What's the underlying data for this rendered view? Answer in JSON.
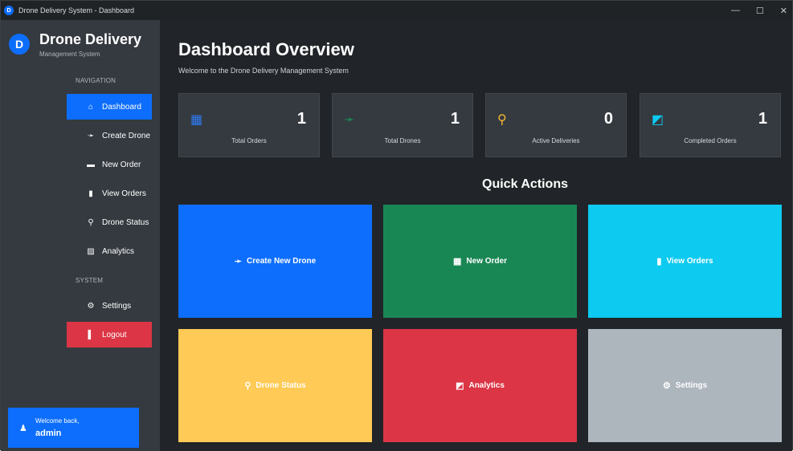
{
  "window": {
    "title": "Drone Delivery System - Dashboard",
    "icon_letter": "D",
    "controls": {
      "minimize": "—",
      "maximize": "☐",
      "close": "✕"
    }
  },
  "sidebar": {
    "logo_letter": "D",
    "brand_title": "Drone Delivery",
    "brand_subtitle": "Management System",
    "nav_label": "NAVIGATION",
    "system_label": "SYSTEM",
    "items": [
      {
        "label": "Dashboard",
        "icon": "home-icon",
        "glyph": "⌂"
      },
      {
        "label": "Create Drone",
        "icon": "drone-icon",
        "glyph": "➛"
      },
      {
        "label": "New Order",
        "icon": "gift-icon",
        "glyph": "▬"
      },
      {
        "label": "View Orders",
        "icon": "clipboard-icon",
        "glyph": "▮"
      },
      {
        "label": "Drone Status",
        "icon": "satellite-icon",
        "glyph": "⚲"
      },
      {
        "label": "Analytics",
        "icon": "chart-icon",
        "glyph": "▨"
      }
    ],
    "settings": {
      "label": "Settings",
      "icon": "gear-icon",
      "glyph": "⚙"
    },
    "logout": {
      "label": "Logout",
      "icon": "door-icon",
      "glyph": "▌"
    },
    "welcome": {
      "line1": "Welcome back,",
      "username": "admin",
      "icon": "user-icon",
      "glyph": "♟"
    }
  },
  "main": {
    "title": "Dashboard Overview",
    "subtitle": "Welcome to the Drone Delivery Management System",
    "stats": [
      {
        "label": "Total Orders",
        "value": "1",
        "icon": "gift-icon",
        "glyph": "▦",
        "color": "#2f7cf6"
      },
      {
        "label": "Total Drones",
        "value": "1",
        "icon": "drone-icon",
        "glyph": "➛",
        "color": "#198754"
      },
      {
        "label": "Active Deliveries",
        "value": "0",
        "icon": "satellite-icon",
        "glyph": "⚲",
        "color": "#f7b731"
      },
      {
        "label": "Completed Orders",
        "value": "1",
        "icon": "chart-icon",
        "glyph": "◩",
        "color": "#0dcaf0"
      }
    ],
    "quick_actions_title": "Quick Actions",
    "actions": [
      {
        "label": "Create New Drone",
        "icon": "drone-icon",
        "glyph": "➛",
        "color": "#0d6efd"
      },
      {
        "label": "New Order",
        "icon": "gift-icon",
        "glyph": "▦",
        "color": "#198754"
      },
      {
        "label": "View Orders",
        "icon": "clipboard-icon",
        "glyph": "▮",
        "color": "#0dcaf0"
      },
      {
        "label": "Drone Status",
        "icon": "satellite-icon",
        "glyph": "⚲",
        "color": "#ffca55"
      },
      {
        "label": "Analytics",
        "icon": "chart-icon",
        "glyph": "◩",
        "color": "#dc3545"
      },
      {
        "label": "Settings",
        "icon": "gear-icon",
        "glyph": "⚙",
        "color": "#adb5bd"
      }
    ]
  }
}
